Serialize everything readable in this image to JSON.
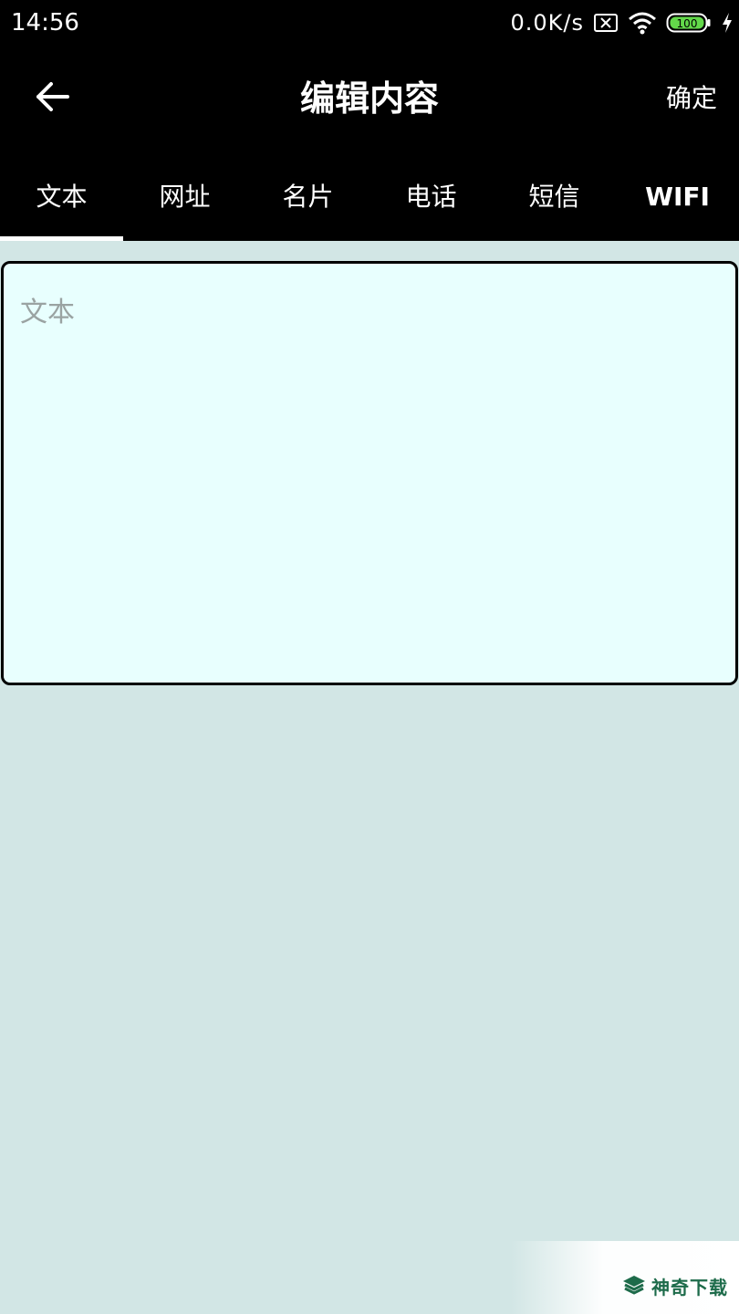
{
  "status_bar": {
    "time": "14:56",
    "network_speed": "0.0K/s",
    "battery_level": "100",
    "icons": [
      "sim-off-icon",
      "wifi-icon",
      "battery-icon",
      "charging-icon"
    ]
  },
  "app_bar": {
    "back_icon": "arrow-left-icon",
    "title": "编辑内容",
    "confirm_label": "确定"
  },
  "tabs": [
    {
      "label": "文本",
      "selected": true
    },
    {
      "label": "网址",
      "selected": false
    },
    {
      "label": "名片",
      "selected": false
    },
    {
      "label": "电话",
      "selected": false
    },
    {
      "label": "短信",
      "selected": false
    },
    {
      "label": "WIFI",
      "selected": false
    }
  ],
  "content": {
    "placeholder": "文本",
    "value": ""
  },
  "watermark": {
    "text": "神奇下载",
    "icon": "logo-icon"
  },
  "colors": {
    "bar_background": "#000000",
    "page_background": "#d2e6e5",
    "input_background": "#e8fffe",
    "watermark_green": "#1d6b4a"
  }
}
